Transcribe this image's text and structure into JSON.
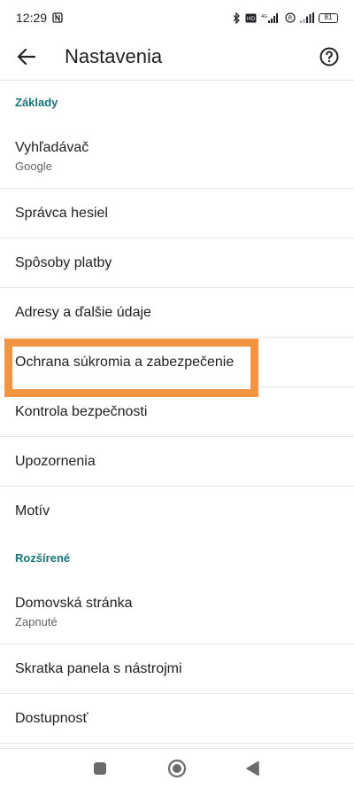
{
  "status_bar": {
    "time": "12:29",
    "battery": "81"
  },
  "app_bar": {
    "title": "Nastavenia"
  },
  "sections": {
    "basics": {
      "header": "Základy",
      "items": [
        {
          "title": "Vyhľadávač",
          "subtitle": "Google"
        },
        {
          "title": "Správca hesiel"
        },
        {
          "title": "Spôsoby platby"
        },
        {
          "title": "Adresy a ďalšie údaje"
        },
        {
          "title": "Ochrana súkromia a zabezpečenie"
        },
        {
          "title": "Kontrola bezpečnosti"
        },
        {
          "title": "Upozornenia"
        },
        {
          "title": "Motív"
        }
      ]
    },
    "advanced": {
      "header": "Rozšírené",
      "items": [
        {
          "title": "Domovská stránka",
          "subtitle": "Zapnuté"
        },
        {
          "title": "Skratka panela s nástrojmi"
        },
        {
          "title": "Dostupnosť"
        }
      ]
    }
  },
  "colors": {
    "section_header": "#1a7378",
    "highlight": "#f39440"
  }
}
